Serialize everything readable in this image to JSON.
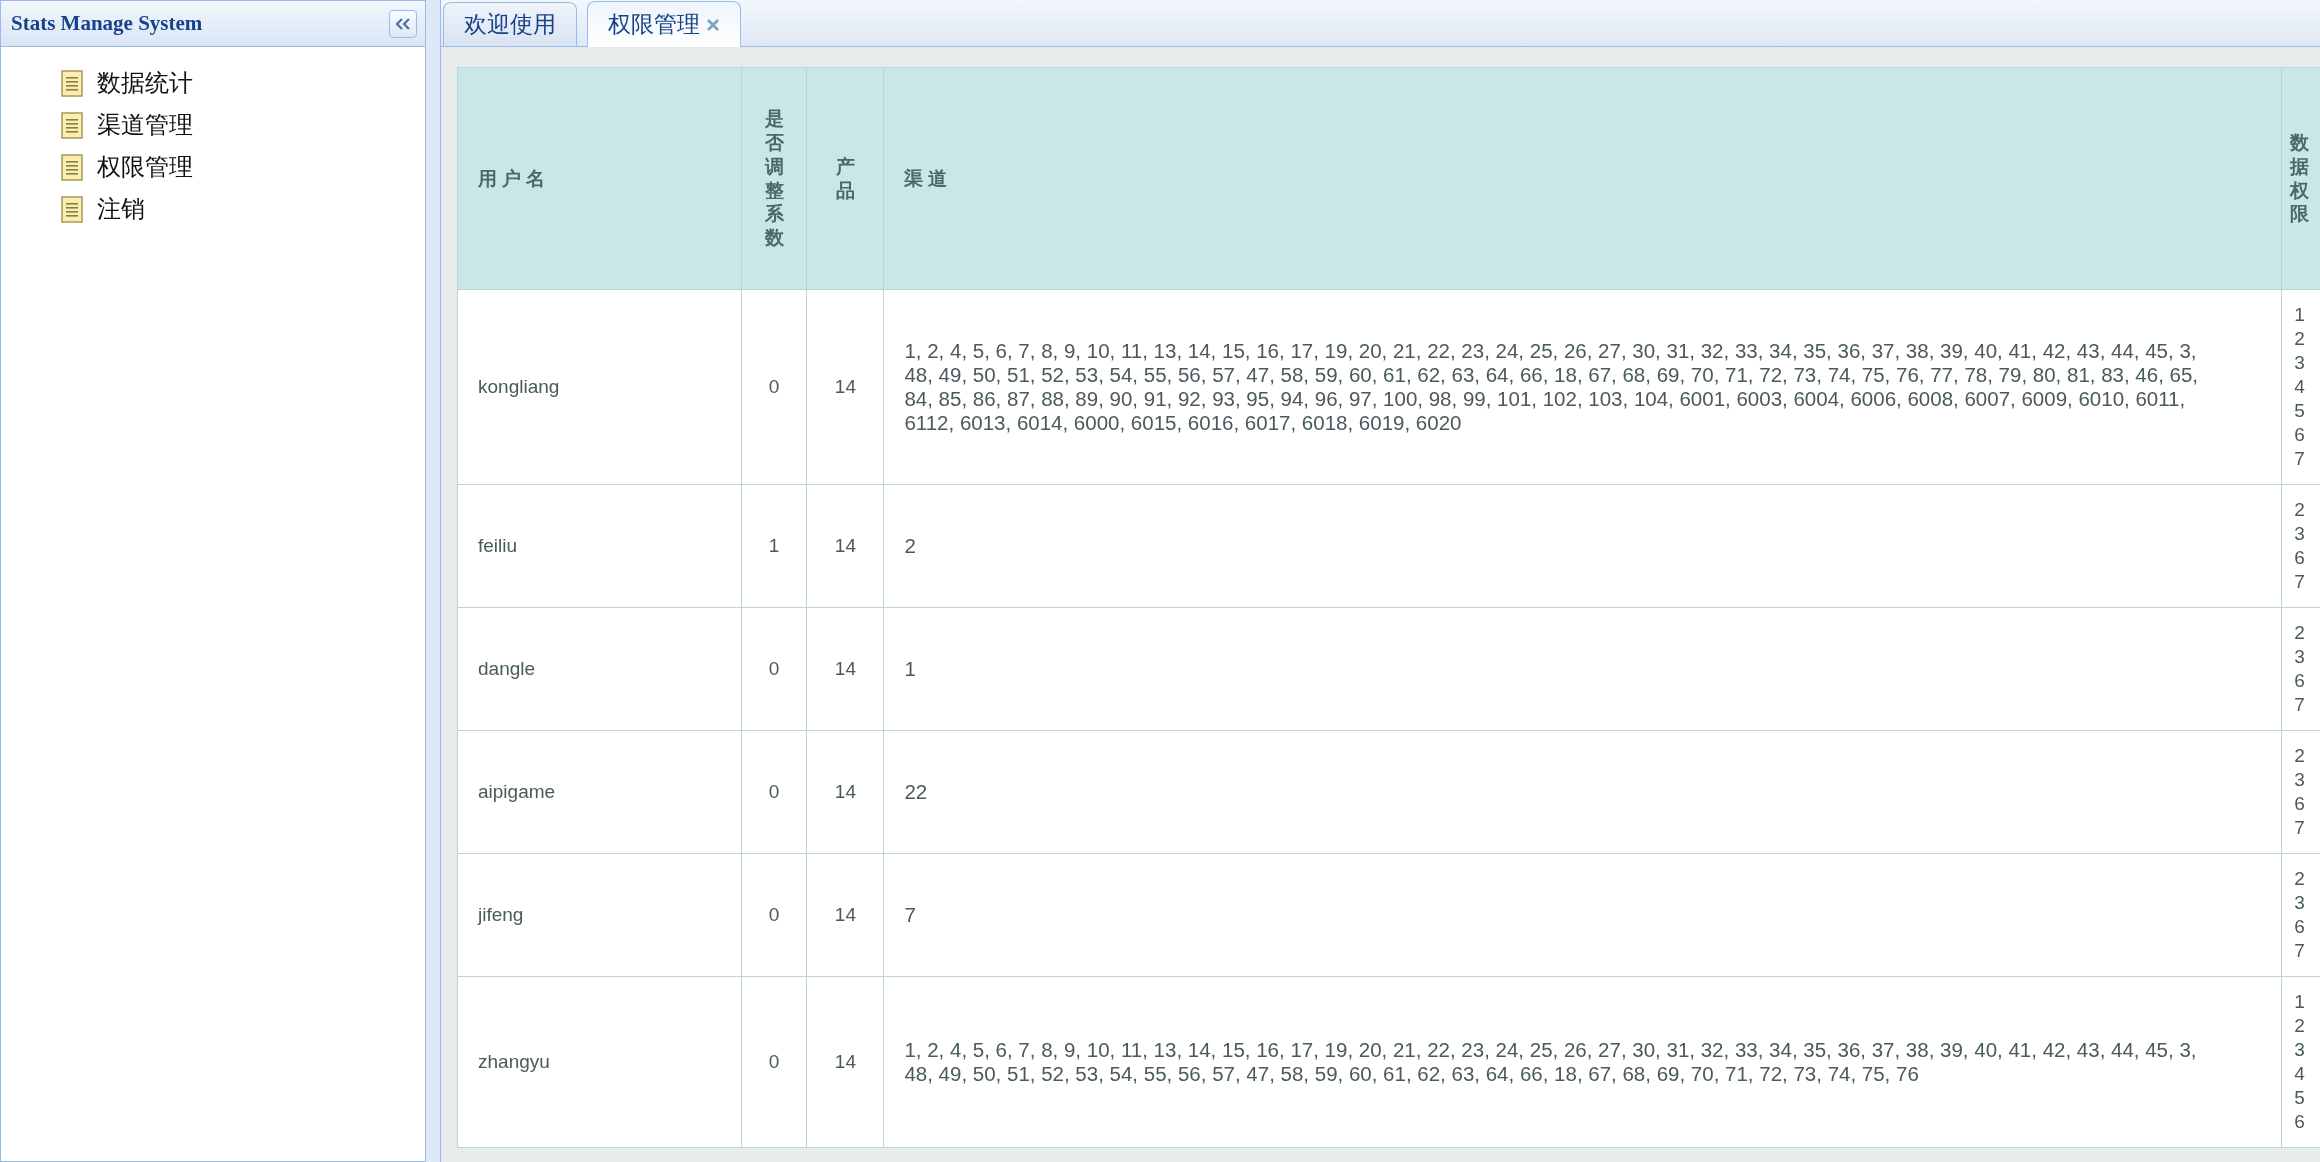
{
  "sidebar": {
    "title": "Stats Manage System",
    "items": [
      {
        "label": "数据统计"
      },
      {
        "label": "渠道管理"
      },
      {
        "label": "权限管理"
      },
      {
        "label": "注销"
      }
    ]
  },
  "tabs": [
    {
      "label": "欢迎使用",
      "selected": false,
      "closable": false
    },
    {
      "label": "权限管理",
      "selected": true,
      "closable": true
    }
  ],
  "table": {
    "columns": [
      "用户名",
      "是否调整系数",
      "产品",
      "渠道",
      "数据权限"
    ],
    "rows": [
      {
        "username": "kongliang",
        "adjust": "0",
        "product": "14",
        "channels": "1, 2, 4, 5, 6, 7, 8, 9, 10, 11, 13, 14, 15, 16, 17, 19, 20, 21, 22, 23, 24, 25, 26, 27, 30, 31, 32, 33, 34, 35, 36, 37, 38, 39, 40, 41, 42, 43, 44, 45, 3, 48, 49, 50, 51, 52, 53, 54, 55, 56, 57, 47, 58, 59, 60, 61, 62, 63, 64, 66, 18, 67, 68, 69, 70, 71, 72, 73, 74, 75, 76, 77, 78, 79, 80, 81, 83, 46, 65, 84, 85, 86, 87, 88, 89, 90, 91, 92, 93, 95, 94, 96, 97, 100, 98, 99, 101, 102, 103, 104, 6001, 6003, 6004, 6006, 6008, 6007, 6009, 6010, 6011, 6112, 6013, 6014, 6000, 6015, 6016, 6017, 6018, 6019, 6020",
        "data_permissions": [
          "1",
          "2",
          "3",
          "4",
          "5",
          "6",
          "7"
        ]
      },
      {
        "username": "feiliu",
        "adjust": "1",
        "product": "14",
        "channels": "2",
        "data_permissions": [
          "2",
          "3",
          "6",
          "7"
        ]
      },
      {
        "username": "dangle",
        "adjust": "0",
        "product": "14",
        "channels": "1",
        "data_permissions": [
          "2",
          "3",
          "6",
          "7"
        ]
      },
      {
        "username": "aipigame",
        "adjust": "0",
        "product": "14",
        "channels": "22",
        "data_permissions": [
          "2",
          "3",
          "6",
          "7"
        ]
      },
      {
        "username": "jifeng",
        "adjust": "0",
        "product": "14",
        "channels": "7",
        "data_permissions": [
          "2",
          "3",
          "6",
          "7"
        ]
      },
      {
        "username": "zhangyu",
        "adjust": "0",
        "product": "14",
        "channels": "1, 2, 4, 5, 6, 7, 8, 9, 10, 11, 13, 14, 15, 16, 17, 19, 20, 21, 22, 23, 24, 25, 26, 27, 30, 31, 32, 33, 34, 35, 36, 37, 38, 39, 40, 41, 42, 43, 44, 45, 3, 48, 49, 50, 51, 52, 53, 54, 55, 56, 57, 47, 58, 59, 60, 61, 62, 63, 64, 66, 18, 67, 68, 69, 70, 71, 72, 73, 74, 75, 76",
        "data_permissions": [
          "1",
          "2",
          "3",
          "4",
          "5",
          "6"
        ]
      }
    ]
  }
}
